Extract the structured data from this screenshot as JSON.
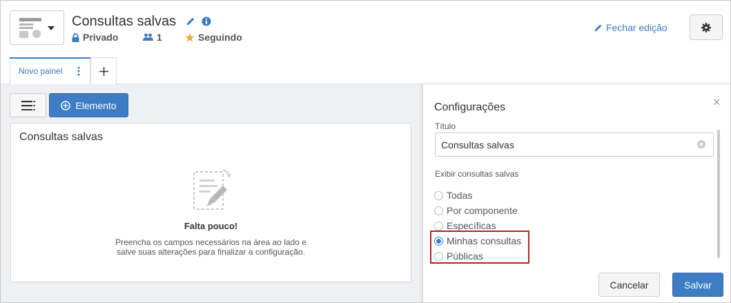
{
  "header": {
    "title": "Consultas salvas",
    "privacy": "Privado",
    "members_count": "1",
    "follow_status": "Seguindo",
    "close_edit_label": "Fechar edição",
    "icons": {
      "app": "page-widgets-icon",
      "edit": "pencil-icon",
      "info": "info-icon",
      "lock": "lock-icon",
      "users": "users-icon",
      "star": "star-icon",
      "settings": "gear-icon"
    }
  },
  "tabs": [
    {
      "label": "Novo painel",
      "active": true
    }
  ],
  "toolbar": {
    "element_label": "Elemento"
  },
  "widget": {
    "title": "Consultas salvas",
    "empty_title": "Falta pouco!",
    "empty_desc_line1": "Preencha os campos necessários na área ao lado e",
    "empty_desc_line2": "salve suas alterações para finalizar a configuração."
  },
  "config": {
    "title": "Configurações",
    "field_label": "Título",
    "field_value": "Consultas salvas",
    "section_label": "Exibir consultas salvas",
    "options": [
      {
        "label": "Todas",
        "checked": false
      },
      {
        "label": "Por componente",
        "checked": false
      },
      {
        "label": "Específicas",
        "checked": false
      },
      {
        "label": "Minhas consultas",
        "checked": true
      },
      {
        "label": "Públicas",
        "checked": false
      }
    ],
    "cancel_label": "Cancelar",
    "save_label": "Salvar"
  },
  "colors": {
    "accent": "#3c7dc4",
    "link": "#3a7bbf",
    "star": "#f0ad4e",
    "highlight": "#b22222",
    "panel_bg": "#eef0f3"
  }
}
